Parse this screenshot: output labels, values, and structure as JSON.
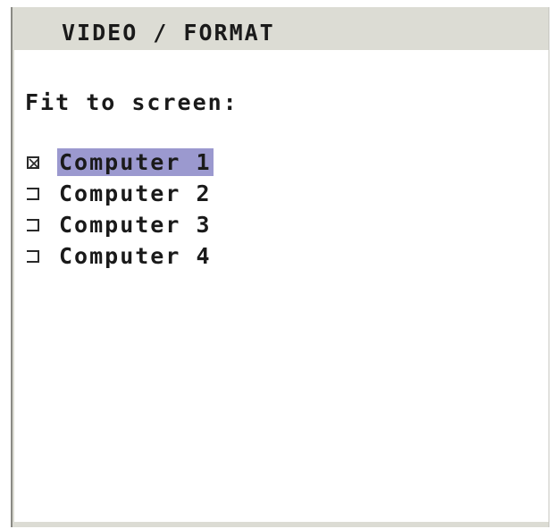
{
  "window": {
    "title": "VIDEO / FORMAT"
  },
  "panel": {
    "heading": "Fit to screen:",
    "items": [
      {
        "label": "Computer 1",
        "checked": true,
        "selected": true
      },
      {
        "label": "Computer 2",
        "checked": false,
        "selected": false
      },
      {
        "label": "Computer 3",
        "checked": false,
        "selected": false
      },
      {
        "label": "Computer 4",
        "checked": false,
        "selected": false
      }
    ]
  },
  "colors": {
    "selection_highlight": "#9b99cf",
    "title_bar": "#dcdcd4",
    "text": "#1a1a1a",
    "background": "#ffffff"
  }
}
